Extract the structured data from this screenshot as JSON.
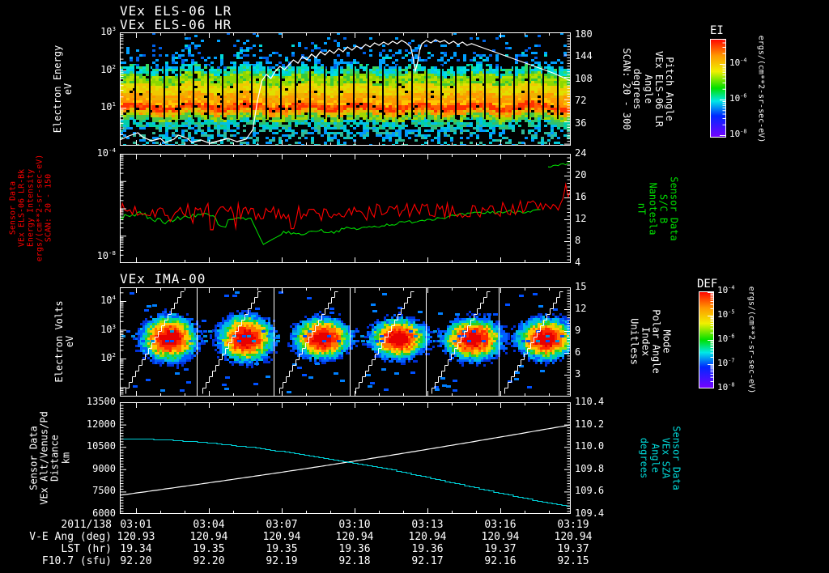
{
  "colors": {
    "white": "#ffffff",
    "red": "#ff0000",
    "green": "#00e000",
    "cyan": "#00d8d8"
  },
  "panels": {
    "els": {
      "titles": [
        "VEx ELS-06 LR",
        "VEx ELS-06 HR"
      ],
      "left_label_lines": [
        "Electron Energy",
        "eV"
      ],
      "left_ticks": [
        "10^3",
        "10^2",
        "10^1"
      ],
      "right_label_lines": [
        "Pitch Angle",
        "VEx ELS-06 LR",
        "Angle",
        "degrees",
        "SCAN: 20 - 300"
      ],
      "right_ticks": [
        "180",
        "144",
        "108",
        "72",
        "36"
      ]
    },
    "bfield": {
      "left_label_lines": [
        "Sensor Data",
        "VEx ELS-06 LR-Bk",
        "Energy Intensity",
        "ergs/(cm**2-sr-sec-eV)",
        "SCAN: 20 - 150"
      ],
      "left_ticks": [
        "10^-4",
        "10^-8"
      ],
      "right_label_lines": [
        "Sensor Data",
        "S/C B",
        "Nanotesla",
        "nT"
      ],
      "right_ticks": [
        "24",
        "20",
        "16",
        "12",
        "8",
        "4"
      ]
    },
    "ima": {
      "title": "VEx IMA-00",
      "left_label_lines": [
        "Electron Volts",
        "eV"
      ],
      "left_ticks": [
        "10^4",
        "10^3",
        "10^2"
      ],
      "right_label_lines": [
        "Mode",
        "Polar Angle",
        "Index",
        "Unitless"
      ],
      "right_ticks": [
        "15",
        "12",
        "9",
        "6",
        "3"
      ]
    },
    "altitude": {
      "left_label_lines": [
        "Sensor Data",
        "VEx Alt/Venus/Pd",
        "Distance",
        "km"
      ],
      "left_ticks": [
        "13500",
        "12000",
        "10500",
        "9000",
        "7500",
        "6000"
      ],
      "right_label_lines": [
        "Sensor Data",
        "VEx SZA",
        "Angle",
        "degrees"
      ],
      "right_ticks": [
        "110.4",
        "110.2",
        "110.0",
        "109.8",
        "109.6",
        "109.4"
      ]
    }
  },
  "colorbars": [
    {
      "title": "EI",
      "ticks": [
        "10^-4",
        "10^-6",
        "10^-8"
      ],
      "units": "ergs/(cm**2-sr-sec-eV)"
    },
    {
      "title": "DEF",
      "ticks": [
        "10^-4",
        "10^-5",
        "10^-6",
        "10^-7",
        "10^-8"
      ],
      "units": "ergs/(cm**2-sr-sec-eV)"
    }
  ],
  "footer": {
    "rows": [
      {
        "label": "2011/138",
        "values": [
          "03:01",
          "03:04",
          "03:07",
          "03:10",
          "03:13",
          "03:16",
          "03:19"
        ]
      },
      {
        "label": "V-E Ang (deg)",
        "values": [
          "120.93",
          "120.94",
          "120.94",
          "120.94",
          "120.94",
          "120.94",
          "120.94"
        ]
      },
      {
        "label": "LST (hr)",
        "values": [
          "19.34",
          "19.35",
          "19.35",
          "19.36",
          "19.36",
          "19.37",
          "19.37"
        ]
      },
      {
        "label": "F10.7 (sfu)",
        "values": [
          "92.20",
          "92.20",
          "92.19",
          "92.18",
          "92.17",
          "92.16",
          "92.15"
        ]
      }
    ]
  },
  "chart_data": [
    {
      "type": "heatmap",
      "panel": "VEx ELS-06 electron spectrogram",
      "title": "VEx ELS-06 LR / VEx ELS-06 HR",
      "x_start": "03:01",
      "x_end": "03:19",
      "x_tick_interval": "3 min",
      "ylabel": "Electron Energy eV",
      "y_scale": "log",
      "y_ticks": [
        1000,
        100,
        10
      ],
      "right_axis_label": "Pitch Angle VEx ELS-06 LR Angle degrees SCAN: 20 - 300",
      "right_ticks": [
        180,
        144,
        108,
        72,
        36
      ],
      "colorbar_title": "EI",
      "colorbar_units": "ergs/(cm**2-sr-sec-eV)",
      "colorbar_ticks": [
        "1e-4",
        "1e-6",
        "1e-8"
      ],
      "description": "Banded spectrogram: sparse blue speckle above ~70 eV, dense cyan 40-70 eV, green-yellow 15-40 eV, intense orange-red band near 8-12 eV, green 5-8 eV, cyan speckle below; ~30 vertical sweep boundaries. White pitch-angle overlay near 10-30 deg until ~03:06, jumps to 120-170 deg, brief dip near 03:12, slow decline to ~120 deg by 03:19."
    },
    {
      "type": "line",
      "panel": "background intensity and magnetic field",
      "left_axis": {
        "label": "Sensor Data VEx ELS-06 LR-Bk Energy Intensity ergs/(cm**2-sr-sec-eV) SCAN: 20 - 150",
        "scale": "log",
        "range": [
          "1e-8",
          "1e-4"
        ]
      },
      "right_axis": {
        "label": "Sensor Data S/C B Nanotesla nT",
        "range": [
          4,
          24
        ]
      },
      "x": [
        "03:01",
        "03:04",
        "03:07",
        "03:10",
        "03:13",
        "03:16",
        "03:19"
      ],
      "series": [
        {
          "name": "ELS-06 LR-Bk intensity",
          "color": "#ff0000",
          "description": "noisy trace near 1e-6 with spikes, shallow dip 03:07-03:11, rising after 03:16 with large spike near 03:19"
        },
        {
          "name": "S/C B (nT)",
          "color": "#00e000",
          "values": [
            12.4,
            12.6,
            8.6,
            10.4,
            12.0,
            13.4,
            22.0
          ],
          "description": "sharp drop to ~7.5 nT near 03:06.5, slow recovery, jumps to ~22 nT at far right"
        }
      ]
    },
    {
      "type": "heatmap",
      "panel": "VEx IMA-00 ion spectrogram",
      "title": "VEx IMA-00",
      "x_start": "03:01",
      "x_end": "03:19",
      "ylabel": "Electron Volts eV",
      "y_scale": "log",
      "y_ticks": [
        10000,
        1000,
        100
      ],
      "right_axis_label": "Mode Polar Angle Index Unitless",
      "right_ticks": [
        15,
        12,
        9,
        6,
        3
      ],
      "colorbar_title": "DEF",
      "colorbar_units": "ergs/(cm**2-sr-sec-eV)",
      "colorbar_ticks": [
        "1e-4",
        "1e-5",
        "1e-6",
        "1e-7",
        "1e-8"
      ],
      "description": "Six ion energy sweeps, each a blob with red core near 300-800 eV surrounded by yellow-green-cyan-blue halo; white stepped sawtooth polar-angle-index line rising across each sweep; thin white vertical separators between sweeps; scattered blue pixels."
    },
    {
      "type": "line",
      "panel": "altitude and solar zenith angle",
      "left_axis": {
        "label": "Sensor Data VEx Alt/Venus/Pd Distance km",
        "range": [
          6000,
          13500
        ]
      },
      "right_axis": {
        "label": "Sensor Data VEx SZA Angle degrees",
        "range": [
          109.4,
          110.4
        ]
      },
      "x": [
        "03:01",
        "03:04",
        "03:07",
        "03:10",
        "03:13",
        "03:16",
        "03:19"
      ],
      "series": [
        {
          "name": "VEx Alt/Venus/Pd (km)",
          "color": "#ffffff",
          "values": [
            7300,
            8100,
            8900,
            9700,
            10450,
            11200,
            11950
          ]
        },
        {
          "name": "VEx SZA (deg)",
          "color": "#00d8d8",
          "values": [
            110.07,
            110.04,
            109.96,
            109.87,
            109.74,
            109.6,
            109.47
          ]
        }
      ]
    }
  ]
}
